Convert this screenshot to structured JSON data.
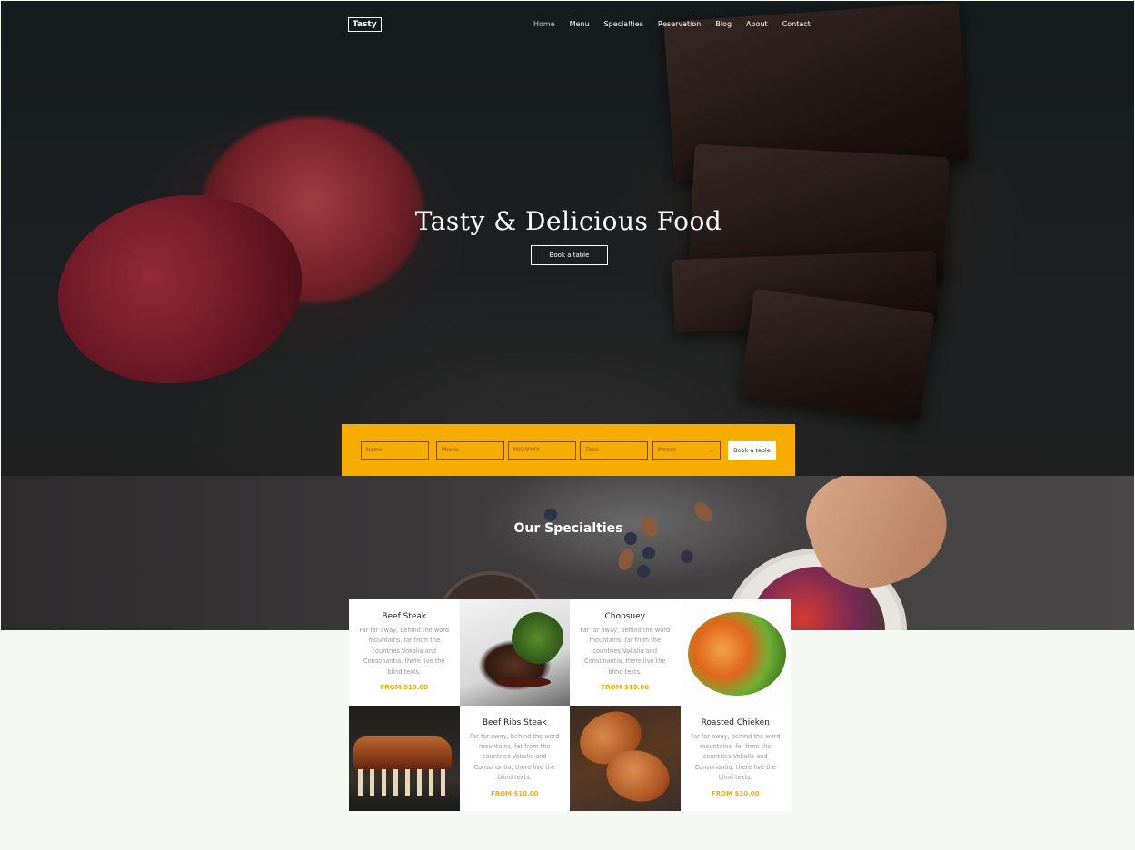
{
  "nav": {
    "logo": "Tasty",
    "items": [
      {
        "label": "Home",
        "active": true
      },
      {
        "label": "Menu"
      },
      {
        "label": "Specialties"
      },
      {
        "label": "Reservation"
      },
      {
        "label": "Blog"
      },
      {
        "label": "About"
      },
      {
        "label": "Contact"
      }
    ]
  },
  "hero": {
    "title": "Tasty & Delicious Food",
    "button_label": "Book a table"
  },
  "booking": {
    "name_placeholder": "Name",
    "phone_placeholder": "Phone",
    "date_placeholder": "M/D/YYYY",
    "time_placeholder": "Time",
    "person_placeholder": "Person",
    "submit_label": "Book a table",
    "accent_color": "#f5ae00"
  },
  "specialties": {
    "title": "Our Specialties",
    "items": [
      {
        "name": "Beef Steak",
        "desc": "Far far away, behind the word mountains, far from the countries Vokalia and Consonantia, there live the blind texts.",
        "price": "FROM $10.00"
      },
      {
        "name": "Chopsuey",
        "desc": "Far far away, behind the word mountains, far from the countries Vokalia and Consonantia, there live the blind texts.",
        "price": "FROM $10.00"
      },
      {
        "name": "Beef Ribs Steak",
        "desc": "Far far away, behind the word mountains, far from the countries Vokalia and Consonantia, there live the blind texts.",
        "price": "FROM $10.00"
      },
      {
        "name": "Roasted Chieken",
        "desc": "Far far away, behind the word mountains, far from the countries Vokalia and Consonantia, there live the blind texts.",
        "price": "FROM $10.00"
      }
    ]
  }
}
